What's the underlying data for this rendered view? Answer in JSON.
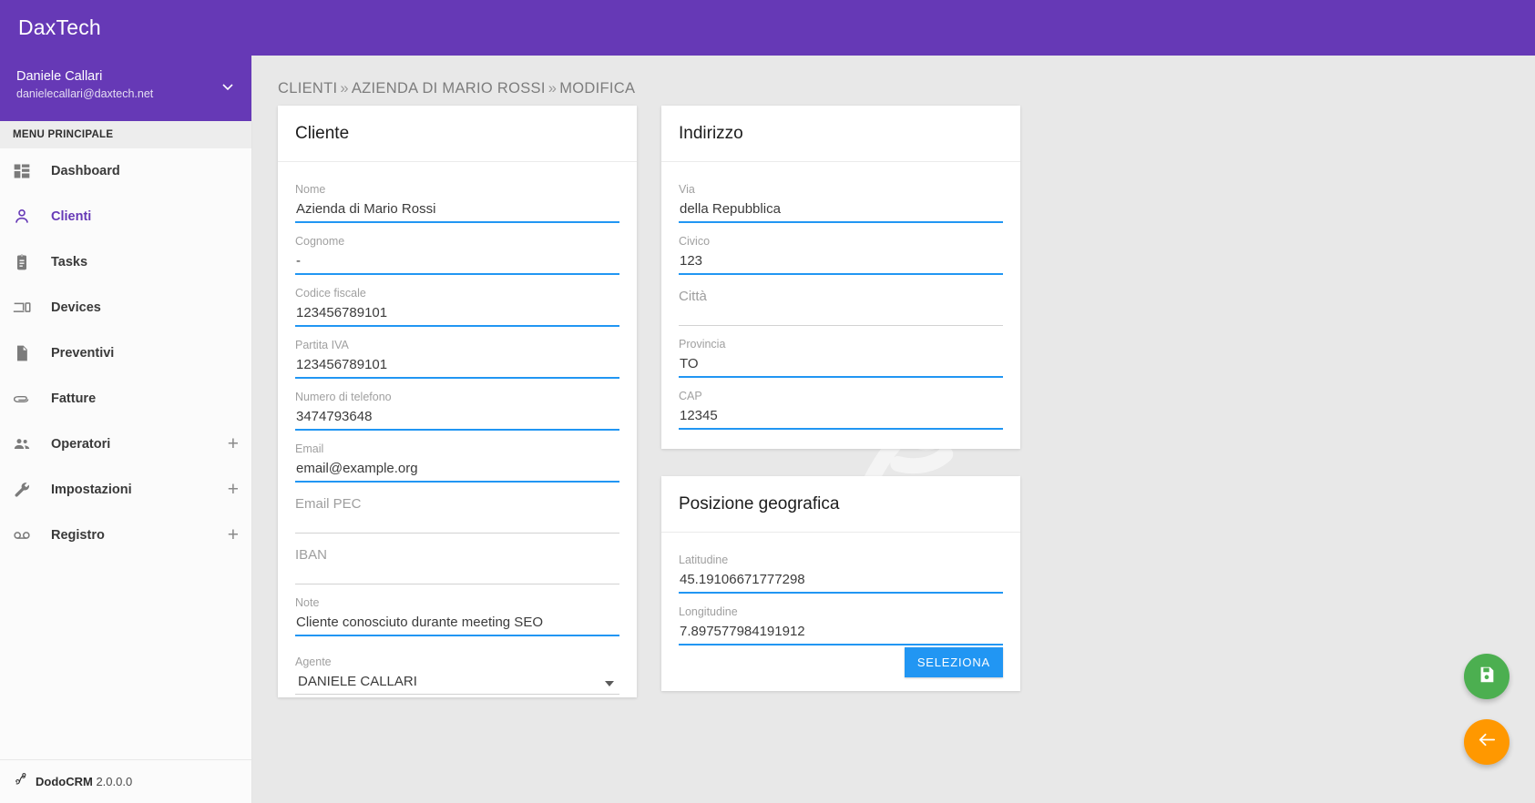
{
  "app": {
    "brand": "DaxTech",
    "version_label": "DodoCRM",
    "version": "2.0.0.0"
  },
  "colors": {
    "brand_purple": "#6639b6",
    "accent_blue": "#2196f3",
    "save_green": "#4caf50",
    "back_orange": "#ff9800",
    "sidebar_bg": "#fbfbfb",
    "content_bg": "#e8e8e8"
  },
  "user": {
    "name": "Daniele Callari",
    "email": "danielecallari@daxtech.net",
    "caret_icon": "chevron-down-icon"
  },
  "sidebar": {
    "section_label": "MENU PRINCIPALE",
    "items": [
      {
        "label": "Dashboard",
        "icon": "dashboard-icon",
        "active": false,
        "expandable": false
      },
      {
        "label": "Clienti",
        "icon": "person-icon",
        "active": true,
        "expandable": false
      },
      {
        "label": "Tasks",
        "icon": "clipboard-icon",
        "active": false,
        "expandable": false
      },
      {
        "label": "Devices",
        "icon": "devices-icon",
        "active": false,
        "expandable": false
      },
      {
        "label": "Preventivi",
        "icon": "document-icon",
        "active": false,
        "expandable": false
      },
      {
        "label": "Fatture",
        "icon": "paperclip-icon",
        "active": false,
        "expandable": false
      },
      {
        "label": "Operatori",
        "icon": "people-icon",
        "active": false,
        "expandable": true,
        "expand_icon": "plus-icon"
      },
      {
        "label": "Impostazioni",
        "icon": "wrench-icon",
        "active": false,
        "expandable": true,
        "expand_icon": "plus-icon"
      },
      {
        "label": "Registro",
        "icon": "voicemail-icon",
        "active": false,
        "expandable": true,
        "expand_icon": "plus-icon"
      }
    ]
  },
  "breadcrumb": {
    "items": [
      "CLIENTI",
      "AZIENDA DI MARIO ROSSI",
      "MODIFICA"
    ],
    "separator": "»"
  },
  "cards": {
    "cliente": {
      "title": "Cliente",
      "fields": [
        {
          "label": "Nome",
          "value": "Azienda di Mario Rossi",
          "filled": true
        },
        {
          "label": "Cognome",
          "value": "-",
          "filled": true
        },
        {
          "label": "Codice fiscale",
          "value": "123456789101",
          "filled": true
        },
        {
          "label": "Partita IVA",
          "value": "123456789101",
          "filled": true
        },
        {
          "label": "Numero di telefono",
          "value": "3474793648",
          "filled": true
        },
        {
          "label": "Email",
          "value": "email@example.org",
          "filled": true
        },
        {
          "label": "Email PEC",
          "value": "",
          "filled": false
        },
        {
          "label": "IBAN",
          "value": "",
          "filled": false
        },
        {
          "label": "Note",
          "value": "Cliente conosciuto durante meeting SEO",
          "filled": true
        }
      ],
      "select": {
        "label": "Agente",
        "value": "DANIELE CALLARI",
        "caret_icon": "dropdown-arrow-icon"
      }
    },
    "indirizzo": {
      "title": "Indirizzo",
      "fields": [
        {
          "label": "Via",
          "value": "della Repubblica",
          "filled": true
        },
        {
          "label": "Civico",
          "value": "123",
          "filled": true
        },
        {
          "label": "Città",
          "value": "",
          "filled": false
        },
        {
          "label": "Provincia",
          "value": "TO",
          "filled": true
        },
        {
          "label": "CAP",
          "value": "12345",
          "filled": true
        }
      ]
    },
    "geo": {
      "title": "Posizione geografica",
      "fields": [
        {
          "label": "Latitudine",
          "value": "45.19106671777298",
          "filled": true
        },
        {
          "label": "Longitudine",
          "value": "7.897577984191912",
          "filled": true
        }
      ],
      "button_label": "SELEZIONA"
    }
  },
  "fabs": [
    {
      "name": "save",
      "icon": "floppy-disk-icon",
      "color": "#4caf50"
    },
    {
      "name": "back",
      "icon": "arrow-left-icon",
      "color": "#ff9800"
    }
  ]
}
